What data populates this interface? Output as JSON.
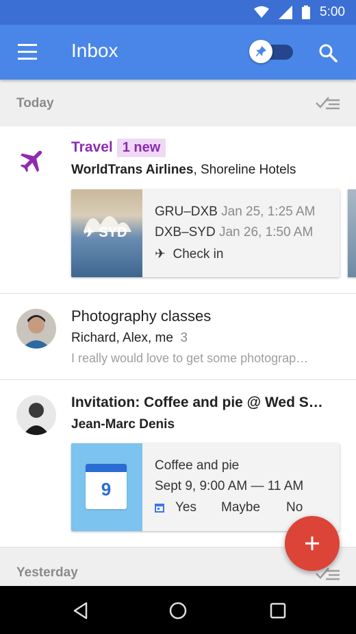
{
  "status_bar": {
    "time": "5:00",
    "icons": [
      "wifi-icon",
      "signal-icon",
      "battery-icon"
    ]
  },
  "app_bar": {
    "title": "Inbox",
    "pin_toggle": "on"
  },
  "sections": {
    "today": "Today",
    "yesterday": "Yesterday"
  },
  "travel": {
    "title": "Travel",
    "badge": "1 new",
    "senders_bold": "WorldTrans Airlines",
    "senders_rest": ", Shoreline Hotels",
    "image_label": "SYD",
    "flights": [
      {
        "route": "GRU–DXB",
        "time": "Jan 25, 1:25 AM"
      },
      {
        "route": "DXB–SYD",
        "time": "Jan 26, 1:50 AM"
      }
    ],
    "action": "Check in"
  },
  "photography": {
    "subject": "Photography classes",
    "participants": "Richard, Alex, me",
    "count": "3",
    "snippet": "I really would love to get some photograp…"
  },
  "invitation": {
    "subject": "Invitation: Coffee and pie @ Wed S…",
    "sender": "Jean-Marc Denis",
    "event_title": "Coffee and pie",
    "event_time": "Sept 9, 9:00 AM — 11 AM",
    "calendar_day": "9",
    "rsvp": {
      "yes": "Yes",
      "maybe": "Maybe",
      "no": "No"
    }
  },
  "colors": {
    "app_bar": "#4a86e8",
    "status_bar": "#3b6fd4",
    "travel": "#8e2bb1",
    "fab": "#db4437",
    "link": "#3b78e7"
  }
}
